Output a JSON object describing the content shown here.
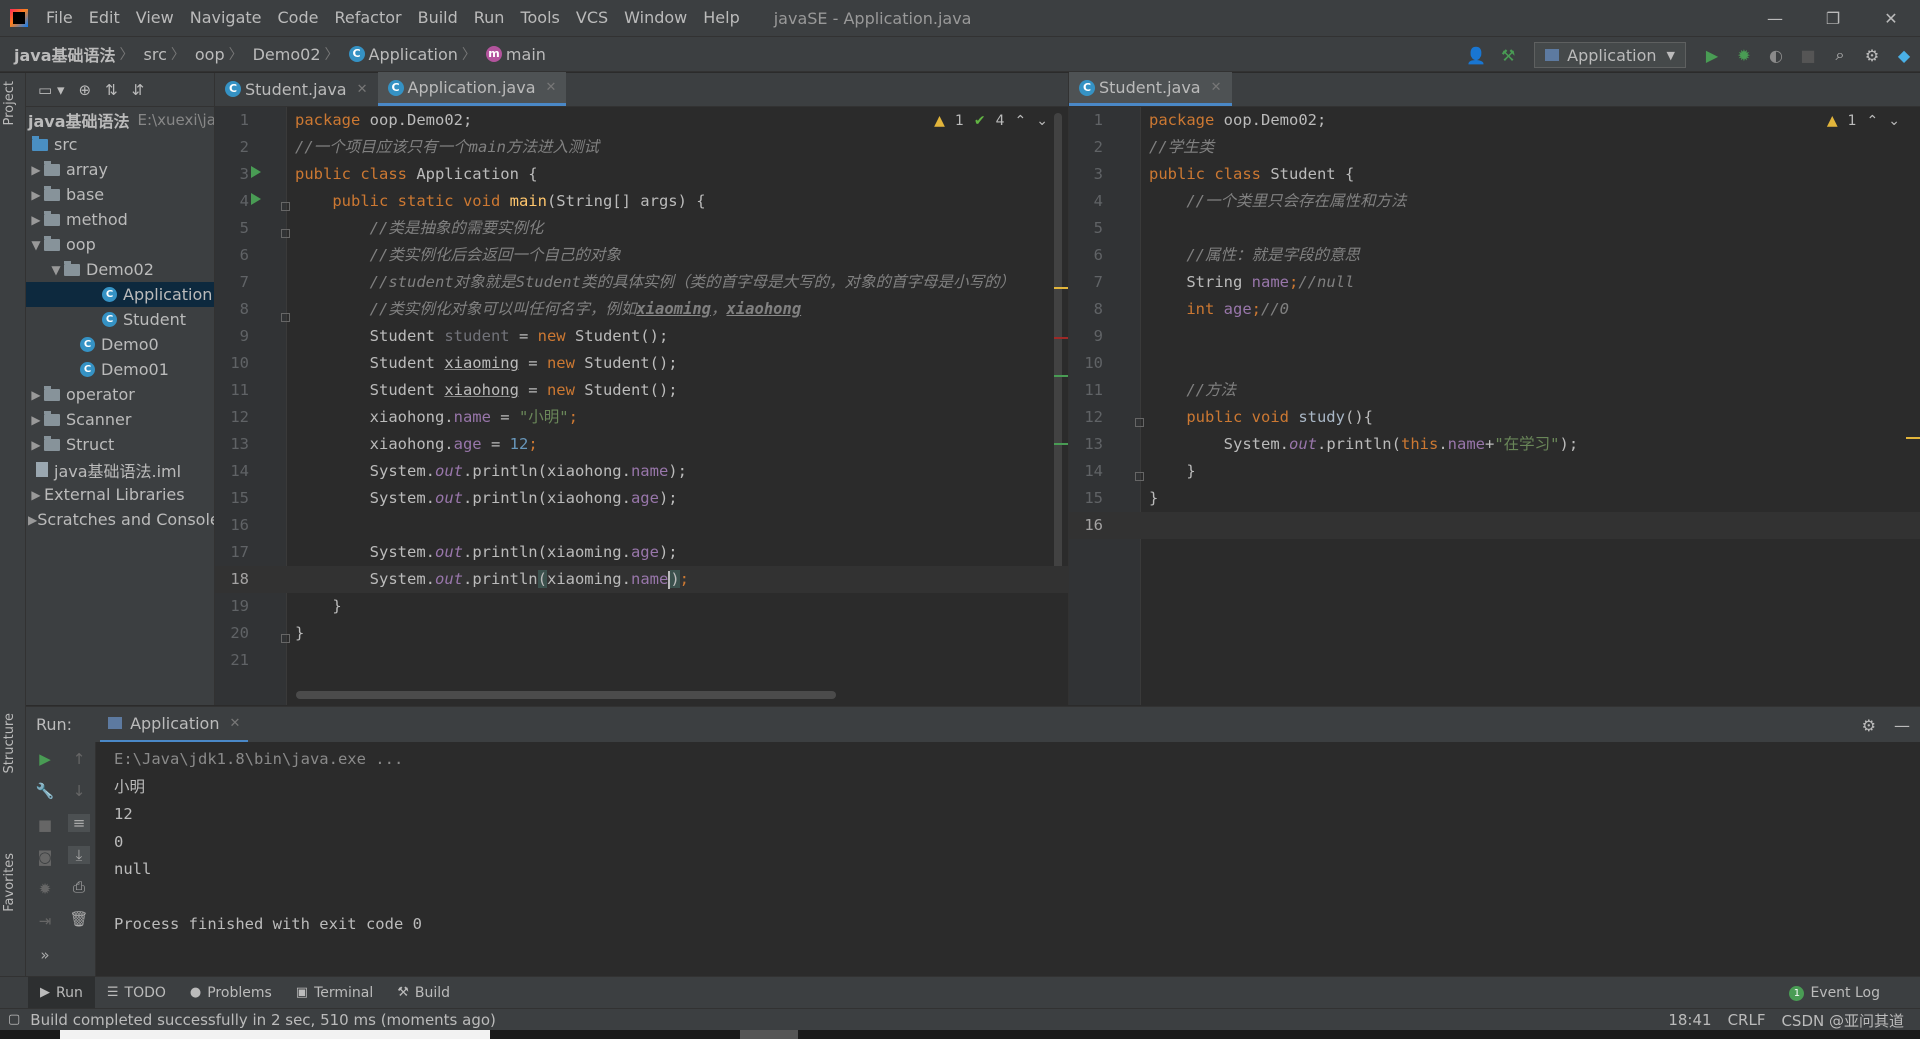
{
  "menubar": {
    "items": [
      "File",
      "Edit",
      "View",
      "Navigate",
      "Code",
      "Refactor",
      "Build",
      "Run",
      "Tools",
      "VCS",
      "Window",
      "Help"
    ],
    "window_title": "javaSE - Application.java"
  },
  "breadcrumb": {
    "project": "java基础语法",
    "items": [
      "src",
      "oop",
      "Demo02",
      "Application",
      "main"
    ]
  },
  "run_config": {
    "label": "Application"
  },
  "project_tree": {
    "root_name": "java基础语法",
    "root_path": "E:\\xuexi\\jav",
    "items": [
      {
        "label": "src"
      },
      {
        "label": "array"
      },
      {
        "label": "base"
      },
      {
        "label": "method"
      },
      {
        "label": "oop"
      },
      {
        "label": "Demo02"
      },
      {
        "label": "Application"
      },
      {
        "label": "Student"
      },
      {
        "label": "Demo0"
      },
      {
        "label": "Demo01"
      },
      {
        "label": "operator"
      },
      {
        "label": "Scanner"
      },
      {
        "label": "Struct"
      },
      {
        "label": "java基础语法.iml"
      },
      {
        "label": "External Libraries"
      },
      {
        "label": "Scratches and Consoles"
      }
    ]
  },
  "left_editor": {
    "tabs": [
      "Student.java",
      "Application.java"
    ],
    "warnings": "1",
    "checks": "4",
    "line_numbers": [
      "1",
      "2",
      "3",
      "4",
      "5",
      "6",
      "7",
      "8",
      "9",
      "10",
      "11",
      "12",
      "13",
      "14",
      "15",
      "16",
      "17",
      "18",
      "19",
      "20",
      "21"
    ],
    "lines": {
      "l1_kw": "package",
      "l1_rest": " oop.Demo02;",
      "l2": "//一个项目应该只有一个main方法进入测试",
      "l3_a": "public class",
      "l3_b": " Application {",
      "l4_a": "    public static void ",
      "l4_fn": "main",
      "l4_b": "(String[] args) {",
      "l5": "        //类是抽象的需要实例化",
      "l6": "        //类实例化后会返回一个自己的对象",
      "l7": "        //student对象就是Student类的具体实例（类的首字母是大写的，对象的首字母是小写的）",
      "l8_a": "        //类实例化对象可以叫任何名字，例如",
      "l8_b": "xiaoming",
      "l8_c": "，",
      "l8_d": "xiaohong",
      "l9_a": "        Student ",
      "l9_b": "student",
      "l9_c": " = ",
      "l9_d": "new",
      "l9_e": " Student();",
      "l10_a": "        Student ",
      "l10_b": "xiaoming",
      "l10_c": " = ",
      "l10_d": "new",
      "l10_e": " Student();",
      "l11_a": "        Student ",
      "l11_b": "xiaohong",
      "l11_c": " = ",
      "l11_d": "new",
      "l11_e": " Student();",
      "l12_a": "        xiaohong.",
      "l12_b": "name",
      "l12_c": " = ",
      "l12_d": "\"小明\"",
      "l12_e": ";",
      "l13_a": "        xiaohong.",
      "l13_b": "age",
      "l13_c": " = ",
      "l13_d": "12",
      "l13_e": ";",
      "l14_a": "        System.",
      "l14_b": "out",
      "l14_c": ".println(xiaohong.",
      "l14_d": "name",
      "l14_e": ");",
      "l15_a": "        System.",
      "l15_b": "out",
      "l15_c": ".println(xiaohong.",
      "l15_d": "age",
      "l15_e": ");",
      "l17_a": "        System.",
      "l17_b": "out",
      "l17_c": ".println(xiaoming.",
      "l17_d": "age",
      "l17_e": ");",
      "l18_a": "        System.",
      "l18_b": "out",
      "l18_c": ".println",
      "l18_p": "(",
      "l18_c2": "xiaoming.",
      "l18_d": "name",
      "l18_p2": ")",
      "l18_e": ";",
      "l19": "    }",
      "l20": "}"
    }
  },
  "right_editor": {
    "tabs": [
      "Student.java"
    ],
    "warnings": "1",
    "line_numbers": [
      "1",
      "2",
      "3",
      "4",
      "5",
      "6",
      "7",
      "8",
      "9",
      "10",
      "11",
      "12",
      "13",
      "14",
      "15",
      "16"
    ],
    "lines": {
      "l1_kw": "package",
      "l1_rest": " oop.Demo02;",
      "l2": "//学生类",
      "l3_a": "public class",
      "l3_b": " Student {",
      "l4": "    //一个类里只会存在属性和方法",
      "l6": "    //属性：就是字段的意思",
      "l7_a": "    String ",
      "l7_b": "name",
      "l7_c": ";",
      "l7_d": "//null",
      "l8_a": "    int ",
      "l8_b": "age",
      "l8_c": ";",
      "l8_d": "//0",
      "l11": "    //方法",
      "l12_a": "    public void ",
      "l12_b": "study",
      "l12_c": "(){",
      "l13_a": "        System.",
      "l13_b": "out",
      "l13_c": ".println(",
      "l13_d": "this",
      "l13_e": ".",
      "l13_f": "name",
      "l13_g": "+",
      "l13_h": "\"在学习\"",
      "l13_i": ");",
      "l14": "    }",
      "l15": "}"
    }
  },
  "run_panel": {
    "label": "Run:",
    "tab": "Application",
    "output": [
      "E:\\Java\\jdk1.8\\bin\\java.exe ...",
      "小明",
      "12",
      "0",
      "null",
      "",
      "Process finished with exit code 0"
    ]
  },
  "bottom_tabs": [
    "Run",
    "TODO",
    "Problems",
    "Terminal",
    "Build"
  ],
  "event_log": {
    "count": "1",
    "label": "Event Log"
  },
  "status": {
    "message": "Build completed successfully in 2 sec, 510 ms (moments ago)",
    "position": "18:41",
    "line_sep": "CRLF",
    "watermark": "CSDN @亚问其道"
  },
  "side_tabs": {
    "project": "Project",
    "structure": "Structure",
    "favorites": "Favorites"
  }
}
